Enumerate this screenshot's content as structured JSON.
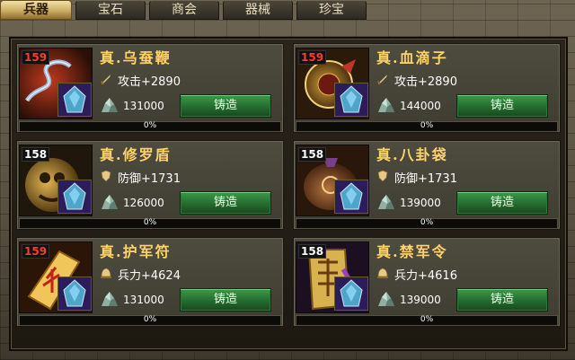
{
  "tabs": [
    {
      "label": "兵器",
      "active": true
    },
    {
      "label": "宝石",
      "active": false
    },
    {
      "label": "商会",
      "active": false
    },
    {
      "label": "器械",
      "active": false
    },
    {
      "label": "珍宝",
      "active": false
    }
  ],
  "forge_label": "铸造",
  "items": [
    {
      "level": "159",
      "name": "真.乌蚕鞭",
      "stat_icon": "sword-icon",
      "stat": "攻击+2890",
      "cost": "131000",
      "progress_text": "0%",
      "progress": 0
    },
    {
      "level": "159",
      "name": "真.血滴子",
      "stat_icon": "sword-icon",
      "stat": "攻击+2890",
      "cost": "144000",
      "progress_text": "0%",
      "progress": 0
    },
    {
      "level": "158",
      "name": "真.修罗盾",
      "stat_icon": "shield-icon",
      "stat": "防御+1731",
      "cost": "126000",
      "progress_text": "0%",
      "progress": 0
    },
    {
      "level": "158",
      "name": "真.八卦袋",
      "stat_icon": "shield-icon",
      "stat": "防御+1731",
      "cost": "139000",
      "progress_text": "0%",
      "progress": 0
    },
    {
      "level": "159",
      "name": "真.护军符",
      "stat_icon": "helmet-icon",
      "stat": "兵力+4624",
      "cost": "131000",
      "progress_text": "0%",
      "progress": 0
    },
    {
      "level": "158",
      "name": "真.禁军令",
      "stat_icon": "helmet-icon",
      "stat": "兵力+4616",
      "cost": "139000",
      "progress_text": "0%",
      "progress": 0
    }
  ],
  "colors": {
    "level_red": "#ff3b2b",
    "level_white": "#ffffff",
    "name_gold": "#ffd36a",
    "forge_green": "#2f8a3c"
  }
}
